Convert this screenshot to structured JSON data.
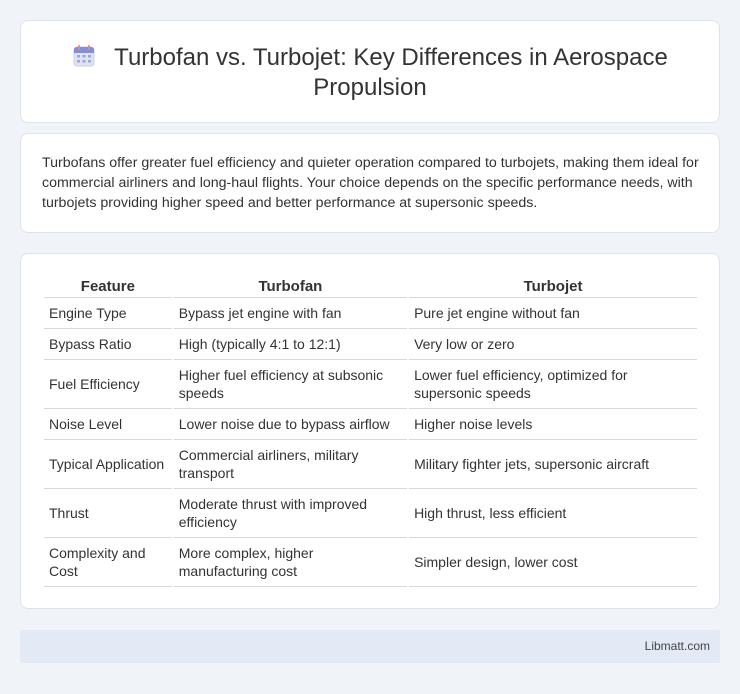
{
  "header": {
    "icon": "calendar-icon",
    "title": "Turbofan vs. Turbojet: Key Differences in Aerospace Propulsion"
  },
  "summary": {
    "text": "Turbofans offer greater fuel efficiency and quieter operation compared to turbojets, making them ideal for commercial airliners and long-haul flights. Your choice depends on the specific performance needs, with turbojets providing higher speed and better performance at supersonic speeds."
  },
  "table": {
    "headers": [
      "Feature",
      "Turbofan",
      "Turbojet"
    ],
    "rows": [
      [
        "Engine Type",
        "Bypass jet engine with fan",
        "Pure jet engine without fan"
      ],
      [
        "Bypass Ratio",
        "High (typically 4:1 to 12:1)",
        "Very low or zero"
      ],
      [
        "Fuel Efficiency",
        "Higher fuel efficiency at subsonic speeds",
        "Lower fuel efficiency, optimized for supersonic speeds"
      ],
      [
        "Noise Level",
        "Lower noise due to bypass airflow",
        "Higher noise levels"
      ],
      [
        "Typical Application",
        "Commercial airliners, military transport",
        "Military fighter jets, supersonic aircraft"
      ],
      [
        "Thrust",
        "Moderate thrust with improved efficiency",
        "High thrust, less efficient"
      ],
      [
        "Complexity and Cost",
        "More complex, higher manufacturing cost",
        "Simpler design, lower cost"
      ]
    ]
  },
  "footer": {
    "brand": "Libmatt.com"
  }
}
